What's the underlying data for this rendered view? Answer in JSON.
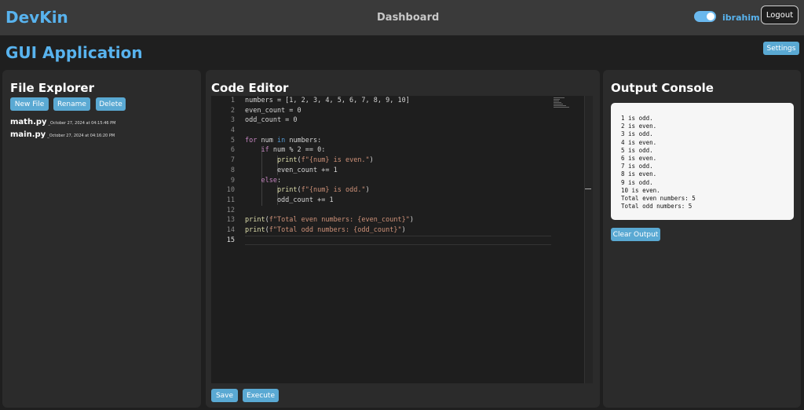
{
  "header": {
    "brand": "DevKin",
    "center": "Dashboard",
    "username": "ibrahim",
    "logout_label": "Logout",
    "toggle_on": true
  },
  "app": {
    "title": "GUI Application",
    "settings_label": "Settings"
  },
  "explorer": {
    "title": "File Explorer",
    "buttons": {
      "new_file": "New File",
      "rename": "Rename",
      "delete": "Delete"
    },
    "files": [
      {
        "name": "math.py",
        "date": "_October 27, 2024 at 04:15:46 PM"
      },
      {
        "name": "main.py",
        "date": "_October 27, 2024 at 04:16:20 PM"
      }
    ]
  },
  "editor": {
    "title": "Code Editor",
    "active_line": 15,
    "save_label": "Save",
    "execute_label": "Execute",
    "lines": [
      "numbers = [1, 2, 3, 4, 5, 6, 7, 8, 9, 10]",
      "even_count = 0",
      "odd_count = 0",
      "",
      "for num in numbers:",
      "    if num % 2 == 0:",
      "        print(f\"{num} is even.\")",
      "        even_count += 1",
      "    else:",
      "        print(f\"{num} is odd.\")",
      "        odd_count += 1",
      "",
      "print(f\"Total even numbers: {even_count}\")",
      "print(f\"Total odd numbers: {odd_count}\")",
      ""
    ]
  },
  "output": {
    "title": "Output Console",
    "clear_label": "Clear Output",
    "lines": [
      "1 is odd.",
      "2 is even.",
      "3 is odd.",
      "4 is even.",
      "5 is odd.",
      "6 is even.",
      "7 is odd.",
      "8 is even.",
      "9 is odd.",
      "10 is even.",
      "Total even numbers: 5",
      "Total odd numbers: 5"
    ]
  },
  "colors": {
    "accent": "#58b3ee",
    "button": "#5aa9d3",
    "topbar": "#3a3a3a",
    "panel": "#2b2b2b"
  }
}
